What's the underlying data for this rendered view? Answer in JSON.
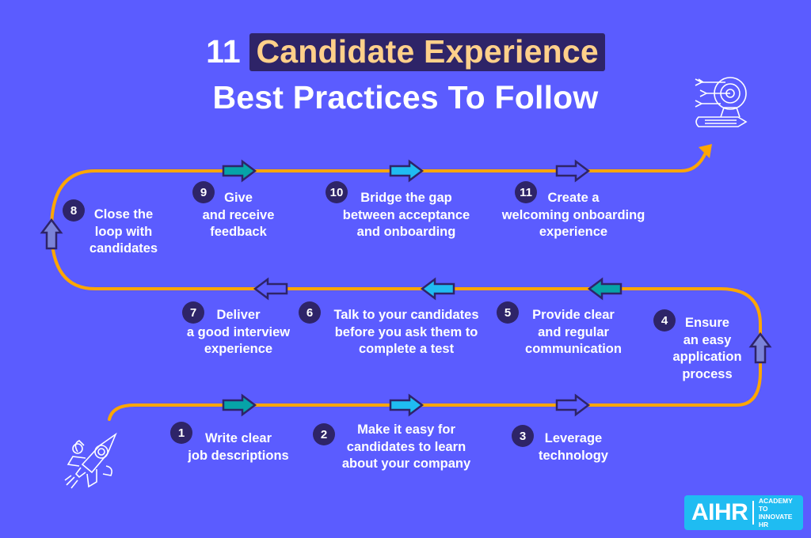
{
  "title": {
    "number": "11",
    "highlight": "Candidate Experience",
    "line2": "Best Practices To Follow"
  },
  "colors": {
    "background": "#5b5cff",
    "path": "#ffa600",
    "badge": "#2e2468",
    "highlight_bg": "#2e2468",
    "highlight_text": "#ffd08a",
    "arrow_teal": "#06a3a8",
    "arrow_cyan": "#1fbcf2",
    "arrow_light": "#7b83d9",
    "arrow_outline": "#2e2468",
    "brand_bg": "#1fbcf2"
  },
  "steps": [
    {
      "number": "1",
      "lines": [
        "Write clear",
        "job descriptions"
      ]
    },
    {
      "number": "2",
      "lines": [
        "Make it easy for",
        "candidates to learn",
        "about your company"
      ]
    },
    {
      "number": "3",
      "lines": [
        "Leverage",
        "technology"
      ]
    },
    {
      "number": "4",
      "lines": [
        "Ensure",
        "an easy",
        "application",
        "process"
      ]
    },
    {
      "number": "5",
      "lines": [
        "Provide clear",
        "and regular",
        "communication"
      ]
    },
    {
      "number": "6",
      "lines": [
        "Talk to your candidates",
        "before you ask them to",
        "complete a test"
      ]
    },
    {
      "number": "7",
      "lines": [
        "Deliver",
        "a good interview",
        "experience"
      ]
    },
    {
      "number": "8",
      "lines": [
        "Close the",
        "loop with",
        "candidates"
      ]
    },
    {
      "number": "9",
      "lines": [
        "Give",
        "and receive",
        "feedback"
      ]
    },
    {
      "number": "10",
      "lines": [
        "Bridge the gap",
        "between acceptance",
        "and onboarding"
      ]
    },
    {
      "number": "11",
      "lines": [
        "Create a",
        "welcoming onboarding",
        "experience"
      ]
    }
  ],
  "icons": {
    "start": "rocket-icon",
    "end": "target-icon"
  },
  "brand": {
    "name": "AIHR",
    "tagline_line1": "ACADEMY TO",
    "tagline_line2": "INNOVATE HR"
  }
}
